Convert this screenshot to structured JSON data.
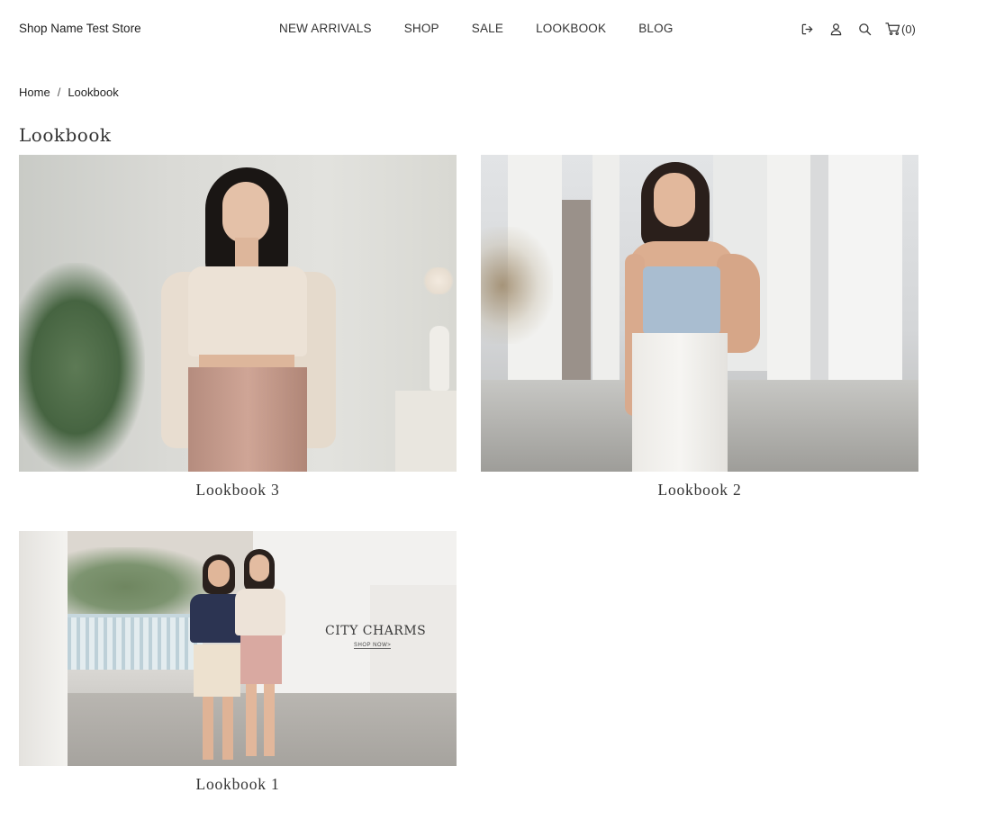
{
  "header": {
    "store_name": "Shop Name Test Store",
    "nav": [
      "NEW ARRIVALS",
      "SHOP",
      "SALE",
      "LOOKBOOK",
      "BLOG"
    ],
    "cart_count": "(0)"
  },
  "icons": [
    "logout-icon",
    "account-icon",
    "search-icon",
    "cart-icon"
  ],
  "breadcrumb": {
    "home": "Home",
    "separator": "/",
    "current": "Lookbook"
  },
  "page": {
    "title": "Lookbook"
  },
  "lookbooks": [
    {
      "title": "Lookbook 3"
    },
    {
      "title": "Lookbook 2"
    },
    {
      "title": "Lookbook 1",
      "banner_title": "CITY CHARMS",
      "banner_cta": "SHOP NOW>"
    }
  ],
  "colors": {
    "text": "#222222",
    "background": "#ffffff"
  }
}
